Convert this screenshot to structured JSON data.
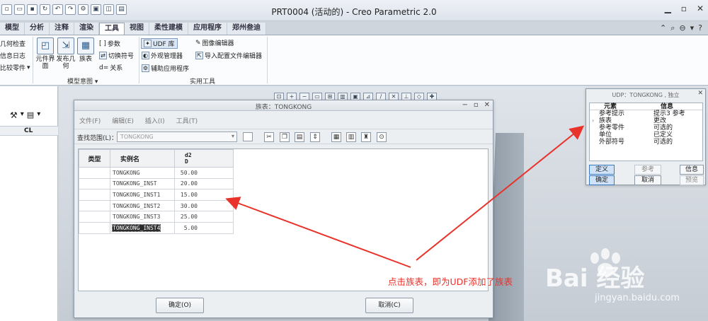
{
  "titlebar": {
    "title": "PRT0004 (活动的) - Creo Parametric 2.0",
    "minimize": "▁",
    "restore": "▫",
    "close": "✕"
  },
  "tabs": [
    "模型",
    "分析",
    "注释",
    "渲染",
    "工具",
    "视图",
    "柔性建模",
    "应用程序",
    "郑州叁迪"
  ],
  "ribbon": {
    "left_items": [
      "几何检查",
      "信息日志",
      "比较零件"
    ],
    "big_buttons": [
      "元件界面",
      "发布几何",
      "族表"
    ],
    "small_items": [
      "参数",
      "切换符号",
      "关系"
    ],
    "group_label_model_intent": "模型意图 ▾",
    "udf_lib": "UDF 库",
    "appearance_mgr": "外观管理器",
    "aux_app": "辅助应用程序",
    "image_editor": "图像编辑器",
    "import_config": "导入配置文件编辑器",
    "group_label_utilities": "实用工具"
  },
  "leftpanel": {
    "col_header": "CL"
  },
  "family_dialog": {
    "title": "族表：TONGKONG",
    "menu": [
      "文件(F)",
      "编辑(E)",
      "插入(I)",
      "工具(T)"
    ],
    "scope_label": "查找范围(L)：",
    "scope_value": "TONGKONG",
    "col_type": "类型",
    "col_name": "实例名",
    "col_d2_line1": "d2",
    "col_d2_line2": "D",
    "rows": [
      {
        "name": "TONGKONG",
        "d2": "50.00"
      },
      {
        "name": "TONGKONG_INST",
        "d2": "20.00"
      },
      {
        "name": "TONGKONG_INST1",
        "d2": "15.00"
      },
      {
        "name": "TONGKONG_INST2",
        "d2": "30.00"
      },
      {
        "name": "TONGKONG_INST3",
        "d2": "25.00"
      },
      {
        "name": "TONGKONG_INST4",
        "d2": "5.00"
      }
    ],
    "ok": "确定(O)",
    "cancel": "取消(C)"
  },
  "udp_dialog": {
    "title": "UDP：TONGKONG , 独立",
    "col_element": "元素",
    "col_info": "信息",
    "rows": [
      {
        "element": "参考提示",
        "info": "提示3 参考"
      },
      {
        "element": "族表",
        "info": "更改"
      },
      {
        "element": "参考零件",
        "info": "可选的"
      },
      {
        "element": "单位",
        "info": "已定义"
      },
      {
        "element": "外部符号",
        "info": "可选的"
      }
    ],
    "define": "定义",
    "reference": "参考",
    "info": "信息",
    "ok": "确定",
    "cancel": "取消",
    "preview": "预览"
  },
  "annotation": "点击族表，即为UDF添加了族表",
  "watermark": {
    "brand": "Bai 经验",
    "url": "jingyan.baidu.com"
  },
  "colors": {
    "annotation_red": "#e8322a",
    "selection_blue": "#cfe2f7"
  }
}
